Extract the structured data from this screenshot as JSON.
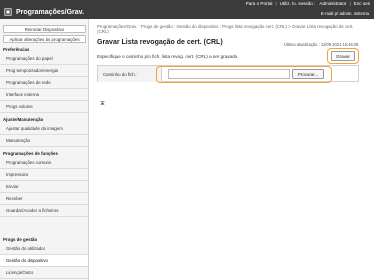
{
  "topbar": {
    "links": [
      "Para o Portal",
      "Utiliz. lo. sessão :"
    ],
    "user": "Administrator",
    "logout": "Enc ses",
    "brand": "Programações/Grav.",
    "mail": "E-mail p/ admin. sistema"
  },
  "sidebar": {
    "restart_label": "Reiniciar Dispositivo",
    "apply_label": "Aplicar alterações às programações",
    "groups": [
      {
        "header": "Preferências",
        "items": [
          "Programações do papel",
          "Prog temporizador/energia",
          "Programações de rede",
          "Interface externa",
          "Progs volume"
        ]
      },
      {
        "header": "Ajuste/Manutenção",
        "items": [
          "Ajustar qualidade da imagem",
          "Manutenção"
        ]
      },
      {
        "header": "Programações de funções",
        "items": [
          "Programações comuns",
          "Impressora",
          "Enviar",
          "Receber",
          "Guardar/Aceder a ficheiros"
        ]
      },
      {
        "header": "Progs de gestão",
        "items": [
          "Gestão do utilizador",
          "Gestão do dispositivo",
          "Licença/Outro"
        ]
      }
    ]
  },
  "main": {
    "breadcrumb": "Programações/Grav. : Progs de gestão : Gestão do dispositivo : Progs lista revogação cert. (CRL) > Gravar Lista revogação de cert. (CRL)",
    "title": "Gravar Lista revogação de cert. (CRL)",
    "last_updated": "Última atualização : 12/09 2021 16:46:28",
    "description": "Especifique o caminho p/o fich. lista revog. cert. (CRL) a ser gravado.",
    "save_label": "Gravar",
    "file_path_label": "Caminho do fich. :",
    "file_path_value": "",
    "browse_label": "Procurar..."
  }
}
